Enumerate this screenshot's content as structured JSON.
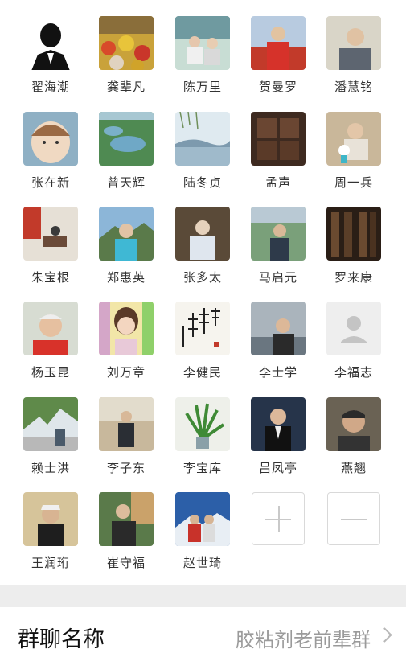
{
  "members": [
    {
      "name": "翟海潮"
    },
    {
      "name": "龚辈凡"
    },
    {
      "name": "陈万里"
    },
    {
      "name": "贺曼罗"
    },
    {
      "name": "潘慧铭"
    },
    {
      "name": "张在新"
    },
    {
      "name": "曾天辉"
    },
    {
      "name": "陆冬贞"
    },
    {
      "name": "孟声"
    },
    {
      "name": "周一兵"
    },
    {
      "name": "朱宝根"
    },
    {
      "name": "郑惠英"
    },
    {
      "name": "张多太"
    },
    {
      "name": "马启元"
    },
    {
      "name": "罗来康"
    },
    {
      "name": "杨玉昆"
    },
    {
      "name": "刘万章"
    },
    {
      "name": "李健民"
    },
    {
      "name": "李士学"
    },
    {
      "name": "李福志"
    },
    {
      "name": "赖士洪"
    },
    {
      "name": "李子东"
    },
    {
      "name": "李宝库"
    },
    {
      "name": "吕凤亭"
    },
    {
      "name": "燕翘"
    },
    {
      "name": "王润珩"
    },
    {
      "name": "崔守福"
    },
    {
      "name": "赵世琦"
    }
  ],
  "actions": {
    "add_icon": "plus-icon",
    "remove_icon": "minus-icon"
  },
  "group_settings": {
    "name_label": "群聊名称",
    "name_value": "胶粘剂老前辈群"
  }
}
